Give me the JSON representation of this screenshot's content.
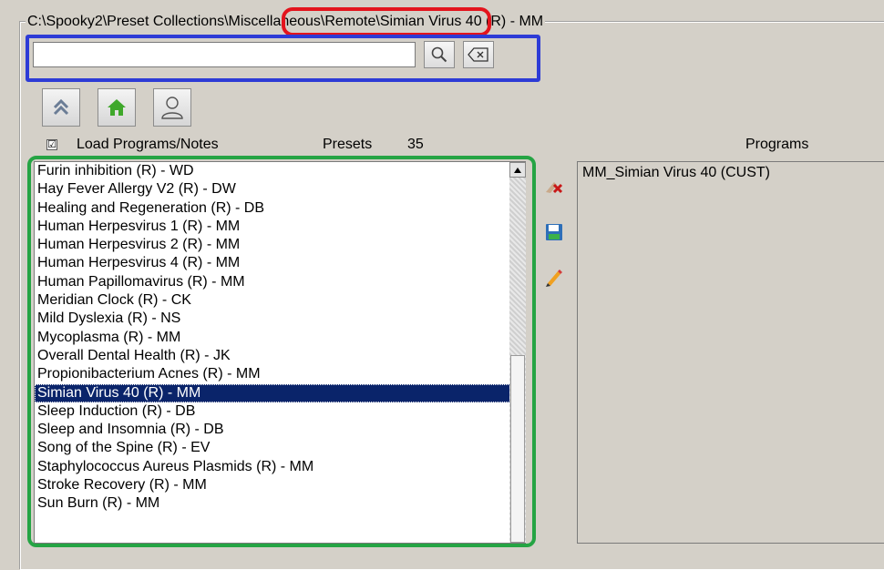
{
  "group": {
    "title": "C:\\Spooky2\\Preset Collections\\Miscellaneous\\Remote\\Simian Virus 40 (R) - MM"
  },
  "search": {
    "value": "",
    "placeholder": "",
    "search_icon": "magnifier-icon",
    "clear_icon": "backspace-clear-icon"
  },
  "nav": {
    "up_icon": "double-chevron-up-icon",
    "home_icon": "home-icon",
    "user_icon": "user-icon"
  },
  "header": {
    "load_checkbox_checked": true,
    "load_checkbox_mark": "☑",
    "load_label": "Load Programs/Notes",
    "presets_label": "Presets",
    "presets_count": "35",
    "programs_label": "Programs"
  },
  "presets": {
    "items": [
      "Furin inhibition (R) - WD",
      "Hay Fever Allergy V2 (R) - DW",
      "Healing and Regeneration (R) - DB",
      "Human Herpesvirus 1 (R) - MM",
      "Human Herpesvirus 2 (R) - MM",
      "Human Herpesvirus 4 (R) - MM",
      "Human Papillomavirus (R) - MM",
      "Meridian Clock (R) - CK",
      "Mild Dyslexia (R) - NS",
      "Mycoplasma (R) - MM",
      "Overall Dental Health (R) - JK",
      "Propionibacterium Acnes (R) - MM",
      "Simian Virus 40 (R) - MM",
      "Sleep Induction (R) - DB",
      "Sleep and Insomnia (R) - DB",
      "Song of the Spine (R) - EV",
      "Staphylococcus Aureus Plasmids (R) - MM",
      "Stroke Recovery (R) - MM",
      "Sun Burn (R) - MM"
    ],
    "selected_index": 12
  },
  "actions": {
    "remove_icon": "remove-preset-icon",
    "save_icon": "save-icon",
    "edit_icon": "edit-pencil-icon"
  },
  "programs": {
    "items": [
      "MM_Simian Virus 40 (CUST)"
    ]
  },
  "colors": {
    "window_bg": "#d4d0c8",
    "selection_bg": "#0a246a",
    "annotation_red": "#e3141d",
    "annotation_blue": "#2d3bd6",
    "annotation_green": "#25a444"
  }
}
